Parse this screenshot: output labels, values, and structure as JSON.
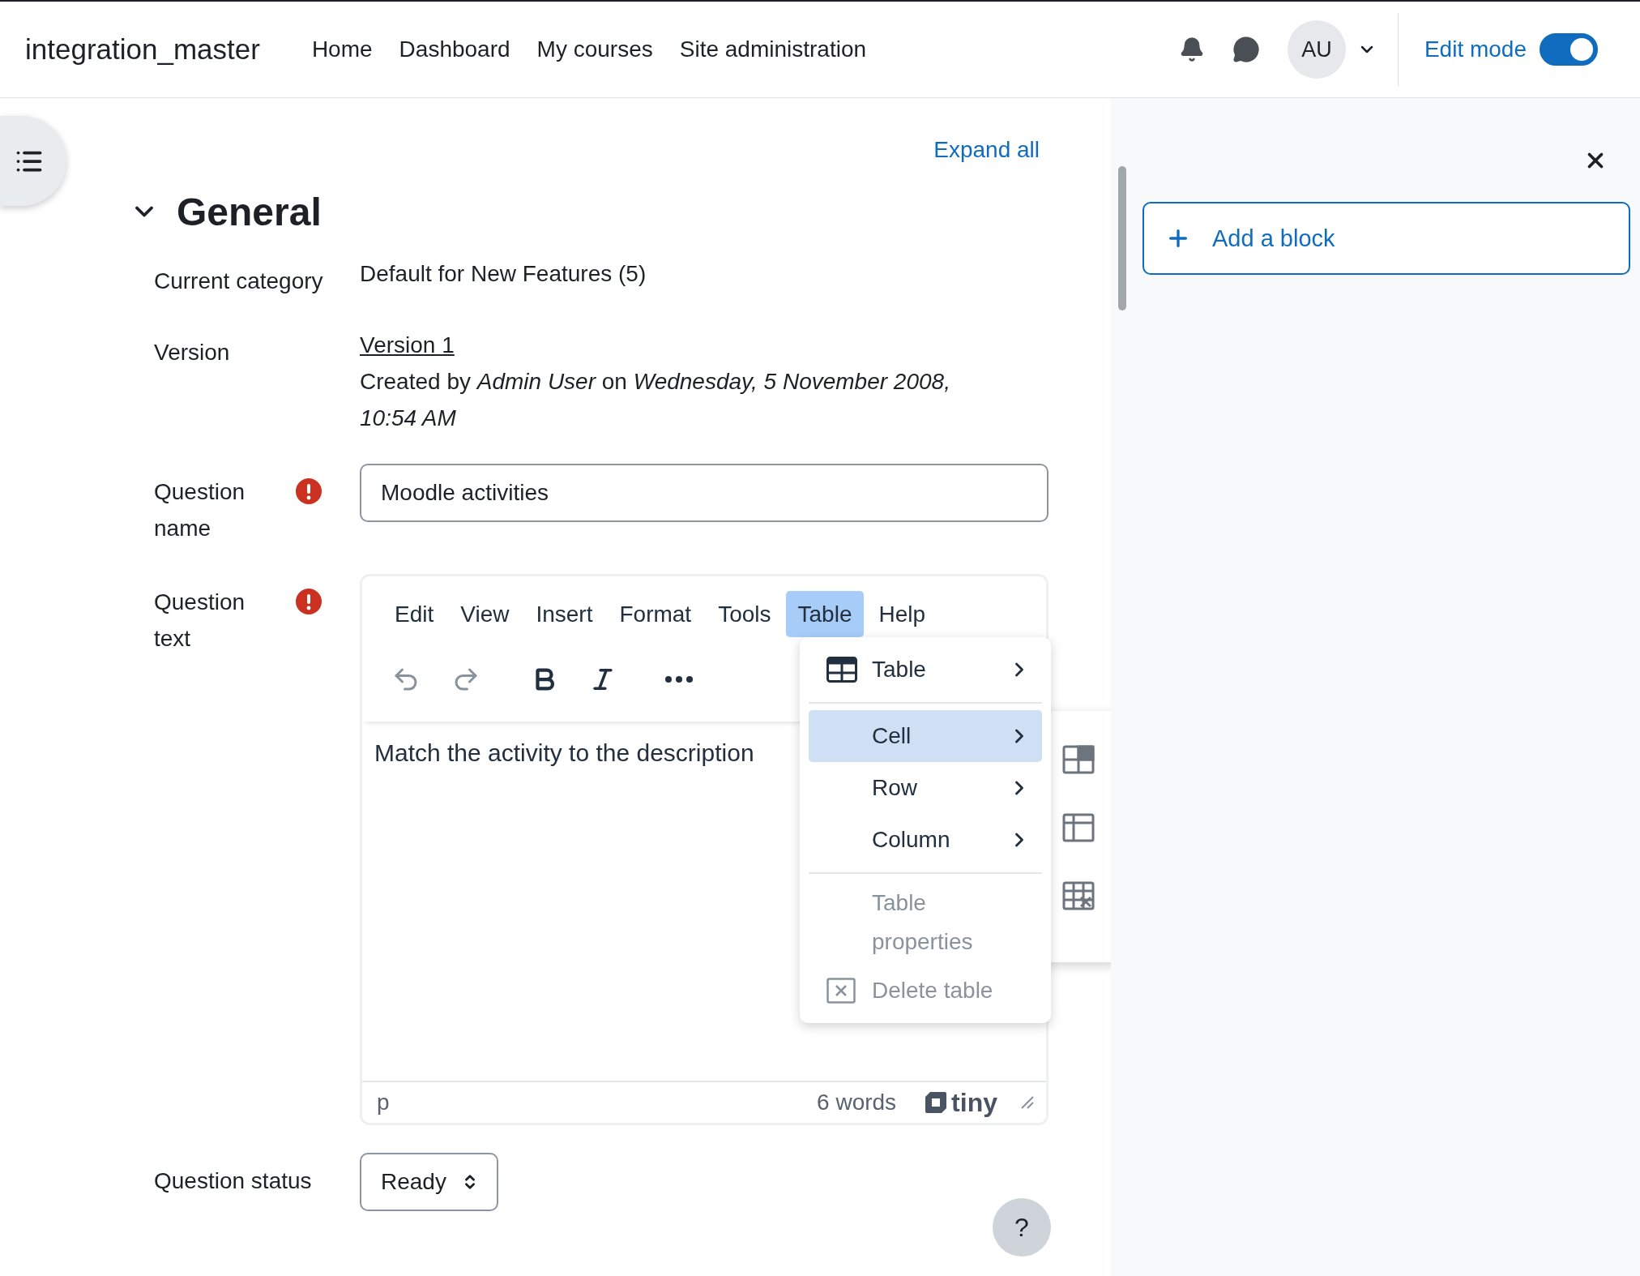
{
  "header": {
    "brand": "integration_master",
    "nav": [
      {
        "label": "Home"
      },
      {
        "label": "Dashboard"
      },
      {
        "label": "My courses"
      },
      {
        "label": "Site administration"
      }
    ],
    "avatar": "AU",
    "edit_mode": {
      "label": "Edit mode",
      "on": true
    }
  },
  "main": {
    "expand_all": "Expand all",
    "section": {
      "title": "General",
      "expanded": true
    },
    "fields": [
      {
        "kind": "static",
        "label": "Current category",
        "value": "Default for New Features (5)"
      },
      {
        "kind": "version",
        "label": "Version",
        "link": "Version 1",
        "text": "Created by *Admin User* on *Wednesday, 5 November 2008, 10:54 AM*"
      },
      {
        "kind": "input",
        "label": "Question name",
        "required": true,
        "value": "Moodle activities"
      },
      {
        "kind": "editor",
        "label": "Question text",
        "required": true
      },
      {
        "kind": "select",
        "label": "Question status",
        "value": "Ready"
      }
    ],
    "editor": {
      "menubar": [
        {
          "label": "Edit",
          "selected": false
        },
        {
          "label": "View",
          "selected": false
        },
        {
          "label": "Insert",
          "selected": false
        },
        {
          "label": "Format",
          "selected": false
        },
        {
          "label": "Tools",
          "selected": false
        },
        {
          "label": "Table",
          "selected": true
        },
        {
          "label": "Help",
          "selected": false
        }
      ],
      "content": "Match the activity to the description",
      "path": "p",
      "word_count": "6 words",
      "brand": "tiny",
      "menu": [
        {
          "kind": "submenu",
          "label": "Table",
          "selected": false,
          "disabled": false
        },
        {
          "kind": "divider"
        },
        {
          "kind": "submenu",
          "label": "Cell",
          "selected": true,
          "disabled": false
        },
        {
          "kind": "submenu",
          "label": "Row",
          "selected": false,
          "disabled": false
        },
        {
          "kind": "submenu",
          "label": "Column",
          "selected": false,
          "disabled": false
        },
        {
          "kind": "divider"
        },
        {
          "kind": "action",
          "label": "Table properties",
          "selected": false,
          "disabled": true
        },
        {
          "kind": "action",
          "label": "Delete table",
          "selected": false,
          "disabled": true
        }
      ]
    },
    "help": "?"
  },
  "drawer": {
    "add_block": "Add a block"
  }
}
